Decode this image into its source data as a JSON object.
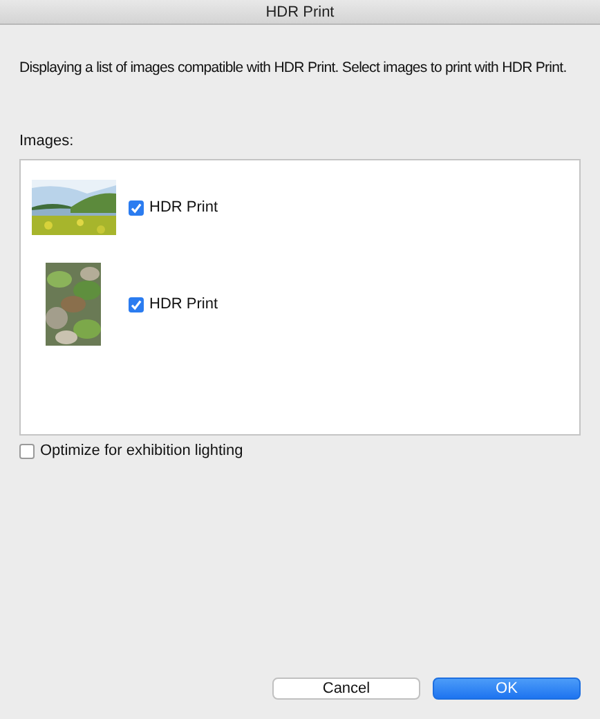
{
  "window": {
    "title": "HDR Print"
  },
  "description": "Displaying a list of images compatible with HDR Print. Select images to print with HDR Print.",
  "images_label": "Images:",
  "images": [
    {
      "kind": "landscape",
      "label": "HDR Print",
      "checked": true
    },
    {
      "kind": "portrait",
      "label": "HDR Print",
      "checked": true
    }
  ],
  "optimize": {
    "label": "Optimize for exhibition lighting",
    "checked": false
  },
  "buttons": [
    {
      "label": "Cancel",
      "kind": "secondary"
    },
    {
      "label": "OK",
      "kind": "primary"
    }
  ]
}
